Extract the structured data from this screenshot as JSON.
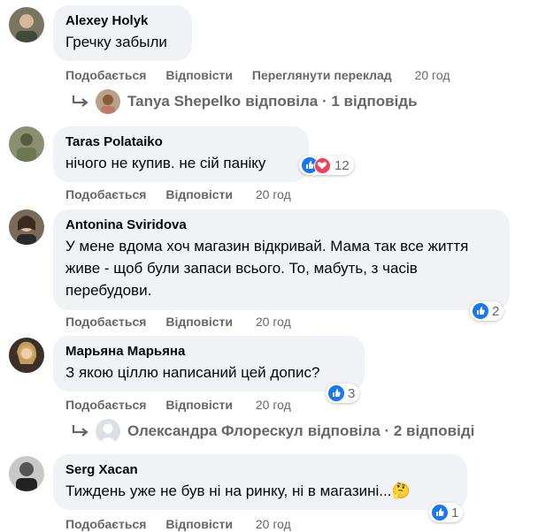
{
  "actions": {
    "like": "Подобається",
    "reply": "Відповісти",
    "translate": "Переглянути переклад"
  },
  "comments": [
    {
      "author": "Alexey Holyk",
      "text": "Гречку забыли",
      "time": "20 год",
      "reply_summary": {
        "name": "Tanya Shepelko",
        "suffix": "відповіла · 1 відповідь"
      }
    },
    {
      "author": "Taras Polataiko",
      "text": "нічого не купив. не сій паніку",
      "time": "20 год",
      "reactions": {
        "count": "12",
        "icons": [
          "like-icon",
          "love-icon"
        ]
      }
    },
    {
      "author": "Antonina Sviridova",
      "text": "У мене вдома хоч магазин відкривай. Мама так все життя живе - щоб були запаси всього. То, мабуть, з часів перебудови.",
      "time": "20 год",
      "reactions": {
        "count": "2",
        "icons": [
          "like-icon"
        ]
      }
    },
    {
      "author": "Марьяна Марьяна",
      "text": "З якою ціллю написаний цей допис?",
      "time": "20 год",
      "reactions": {
        "count": "3",
        "icons": [
          "like-icon"
        ]
      },
      "reply_summary": {
        "name": "Олександра Флорескул",
        "suffix": "відповіла · 2 відповіді"
      }
    },
    {
      "author": "Serg Xacan",
      "text": "Тиждень уже не був ні на ринку, ні в магазині...🤔",
      "time": "20 год",
      "reactions": {
        "count": "1",
        "icons": [
          "like-icon"
        ]
      }
    }
  ],
  "colors": {
    "bubble": "#f0f2f5",
    "meta": "#65676b",
    "like": "#1877f2",
    "love": "#f33e58"
  }
}
